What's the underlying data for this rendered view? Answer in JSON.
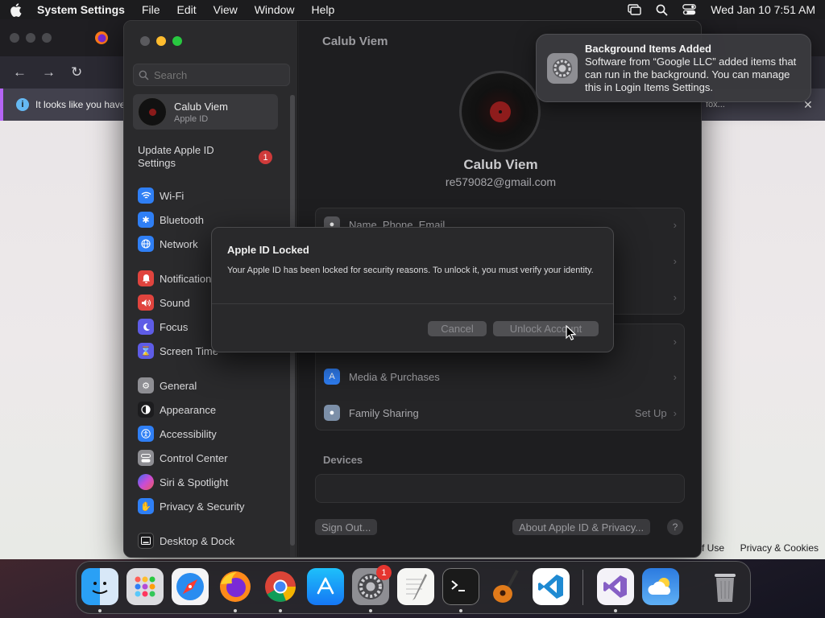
{
  "menubar": {
    "app_name": "System Settings",
    "menus": [
      "File",
      "Edit",
      "View",
      "Window",
      "Help"
    ],
    "clock": "Wed Jan 10  7:51 AM"
  },
  "browser": {
    "infobar_text": "It looks like you have",
    "infobar_text_right": "fox...",
    "footer_left": "of Use",
    "footer_right": "Privacy & Cookies",
    "colors": {
      "accent": "#b565f5"
    }
  },
  "sidebar": {
    "search_placeholder": "Search",
    "account_name": "Calub Viem",
    "account_sub": "Apple ID",
    "update_label": "Update Apple ID Settings",
    "update_badge": "1",
    "items": [
      {
        "label": "Wi-Fi",
        "icon": "wifi-icon",
        "color": "#2f7ff5"
      },
      {
        "label": "Bluetooth",
        "icon": "bluetooth-icon",
        "color": "#2f7ff5"
      },
      {
        "label": "Network",
        "icon": "globe-icon",
        "color": "#2f7ff5"
      },
      {
        "label": "Notifications",
        "icon": "bell-icon",
        "color": "#e0443e"
      },
      {
        "label": "Sound",
        "icon": "speaker-icon",
        "color": "#e0443e"
      },
      {
        "label": "Focus",
        "icon": "moon-icon",
        "color": "#5e5ce6"
      },
      {
        "label": "Screen Time",
        "icon": "hourglass-icon",
        "color": "#5e5ce6"
      },
      {
        "label": "General",
        "icon": "gear-icon",
        "color": "#8e8e93"
      },
      {
        "label": "Appearance",
        "icon": "appearance-icon",
        "color": "#1c1c1e"
      },
      {
        "label": "Accessibility",
        "icon": "accessibility-icon",
        "color": "#2f7ff5"
      },
      {
        "label": "Control Center",
        "icon": "control-center-icon",
        "color": "#8e8e93"
      },
      {
        "label": "Siri & Spotlight",
        "icon": "siri-icon",
        "color": "#b44bd6"
      },
      {
        "label": "Privacy & Security",
        "icon": "hand-icon",
        "color": "#2f7ff5"
      },
      {
        "label": "Desktop & Dock",
        "icon": "dock-icon",
        "color": "#1c1c1e"
      }
    ]
  },
  "content": {
    "title": "Calub Viem",
    "user_name": "Calub Viem",
    "user_email": "re579082@gmail.com",
    "rows": [
      {
        "label": "Name, Phone, Email",
        "icon": "person-card-icon",
        "value": ""
      },
      {
        "label": "Media & Purchases",
        "icon": "app-store-icon",
        "value": ""
      },
      {
        "label": "Family Sharing",
        "icon": "family-icon",
        "value": "Set Up"
      }
    ],
    "devices_heading": "Devices",
    "sign_out_label": "Sign Out...",
    "about_label": "About Apple ID & Privacy...",
    "help_label": "?"
  },
  "alert": {
    "title": "Apple ID Locked",
    "message": "Your Apple ID has been locked for security reasons. To unlock it, you must verify your identity.",
    "cancel_label": "Cancel",
    "unlock_label": "Unlock Account"
  },
  "notification": {
    "title": "Background Items Added",
    "body": "Software from “Google LLC” added items that can run in the background. You can manage this in Login Items Settings."
  },
  "dock": {
    "apps": [
      "finder-icon",
      "launchpad-icon",
      "safari-icon",
      "firefox-icon",
      "chrome-icon",
      "app-store-icon",
      "system-settings-icon",
      "textedit-icon",
      "terminal-icon",
      "garageband-icon",
      "vscode-icon",
      "visual-studio-icon",
      "weather-icon",
      "trash-icon"
    ],
    "settings_badge": "1"
  }
}
